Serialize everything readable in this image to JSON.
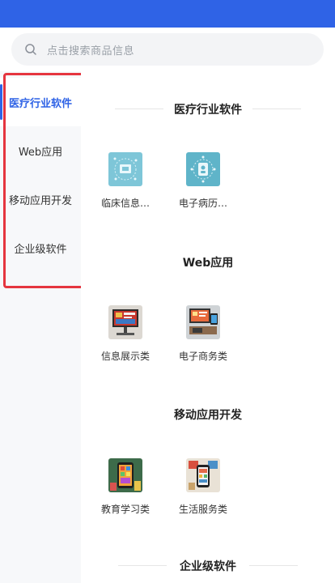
{
  "search": {
    "placeholder": "点击搜索商品信息",
    "icon": "search-icon"
  },
  "sidebar": {
    "items": [
      {
        "label": "医疗行业软件",
        "active": true
      },
      {
        "label": "Web应用",
        "active": false
      },
      {
        "label": "移动应用开发",
        "active": false
      },
      {
        "label": "企业级软件",
        "active": false
      }
    ]
  },
  "sections": [
    {
      "title": "医疗行业软件",
      "items": [
        {
          "label": "临床信息…",
          "icon": "clinical-info-icon"
        },
        {
          "label": "电子病历…",
          "icon": "electronic-record-icon"
        }
      ]
    },
    {
      "title": "Web应用",
      "items": [
        {
          "label": "信息展示类",
          "icon": "info-display-image"
        },
        {
          "label": "电子商务类",
          "icon": "ecommerce-image"
        }
      ]
    },
    {
      "title": "移动应用开发",
      "items": [
        {
          "label": "教育学习类",
          "icon": "education-image"
        },
        {
          "label": "生活服务类",
          "icon": "life-service-image"
        }
      ]
    },
    {
      "title": "企业级软件",
      "items": []
    }
  ],
  "colors": {
    "accent": "#2f63e6",
    "highlight": "#e5353f",
    "sidebar_bg": "#f7f8fa"
  }
}
